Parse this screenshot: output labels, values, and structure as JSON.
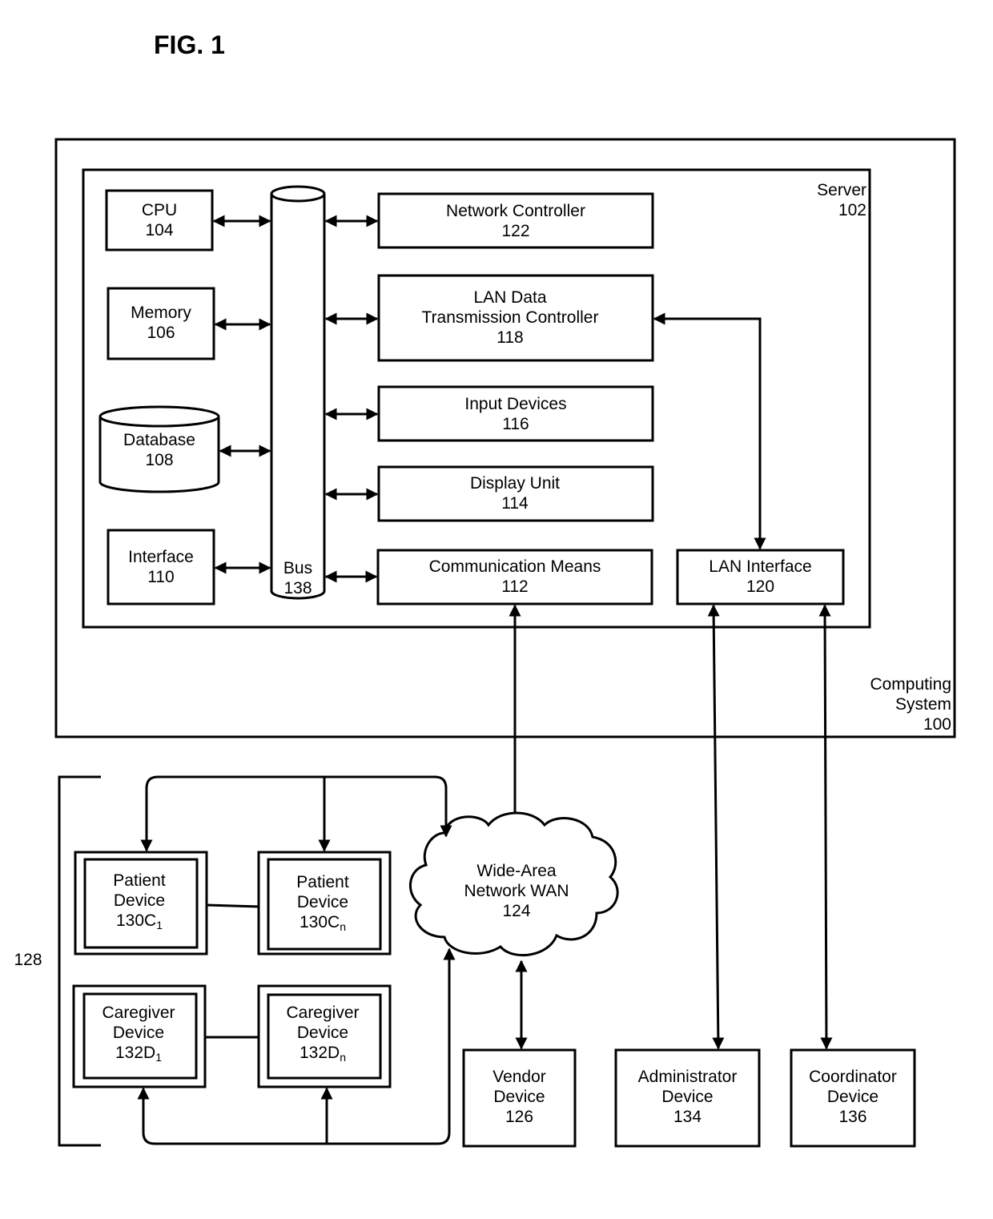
{
  "figure": {
    "title": "FIG. 1"
  },
  "computing_system": {
    "line1": "Computing",
    "line2": "System",
    "ref": "100"
  },
  "server": {
    "name": "Server",
    "ref": "102"
  },
  "components": {
    "cpu": {
      "name": "CPU",
      "ref": "104"
    },
    "memory": {
      "name": "Memory",
      "ref": "106"
    },
    "database": {
      "name": "Database",
      "ref": "108"
    },
    "interface": {
      "name": "Interface",
      "ref": "110"
    },
    "bus": {
      "name": "Bus",
      "ref": "138"
    },
    "network_controller": {
      "name": "Network Controller",
      "ref": "122"
    },
    "lan_data_tx": {
      "line1": "LAN Data",
      "line2": "Transmission Controller",
      "ref": "118"
    },
    "input_devices": {
      "name": "Input Devices",
      "ref": "116"
    },
    "display_unit": {
      "name": "Display Unit",
      "ref": "114"
    },
    "communication_means": {
      "name": "Communication Means",
      "ref": "112"
    },
    "lan_interface": {
      "name": "LAN Interface",
      "ref": "120"
    }
  },
  "wan": {
    "line1": "Wide-Area",
    "line2": "Network WAN",
    "ref": "124"
  },
  "group": {
    "ref": "128"
  },
  "devices": {
    "patient1": {
      "line1": "Patient",
      "line2": "Device",
      "ref": "130C",
      "sub": "1"
    },
    "patientn": {
      "line1": "Patient",
      "line2": "Device",
      "ref": "130C",
      "sub": "n"
    },
    "caregiver1": {
      "line1": "Caregiver",
      "line2": "Device",
      "ref": "132D",
      "sub": "1"
    },
    "caregivern": {
      "line1": "Caregiver",
      "line2": "Device",
      "ref": "132D",
      "sub": "n"
    },
    "vendor": {
      "line1": "Vendor",
      "line2": "Device",
      "ref": "126"
    },
    "administrator": {
      "line1": "Administrator",
      "line2": "Device",
      "ref": "134"
    },
    "coordinator": {
      "line1": "Coordinator",
      "line2": "Device",
      "ref": "136"
    }
  }
}
